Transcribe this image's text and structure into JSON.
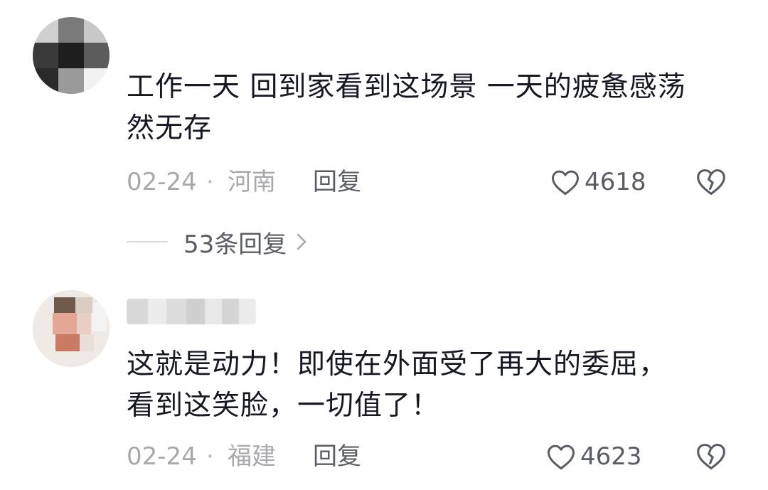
{
  "comments": [
    {
      "text": "工作一天 回到家看到这场景 一天的疲惫感荡\n然无存",
      "date": "02-24",
      "separator": "·",
      "location": "河南",
      "reply_label": "回复",
      "like_count": "4618",
      "replies_label": "53条回复",
      "icons": {
        "like": "heart-outline-icon",
        "dislike": "broken-heart-icon",
        "expand": "chevron-right-icon"
      }
    },
    {
      "text": "这就是动力！即使在外面受了再大的委屈，\n看到这笑脸，一切值了！",
      "date": "02-24",
      "separator": "·",
      "location": "福建",
      "reply_label": "回复",
      "like_count": "4623",
      "icons": {
        "like": "heart-outline-icon",
        "dislike": "broken-heart-icon"
      }
    }
  ],
  "colors": {
    "primary_text": "#161823",
    "secondary_text": "#a8a8ad",
    "action_text": "#5b5d66"
  }
}
